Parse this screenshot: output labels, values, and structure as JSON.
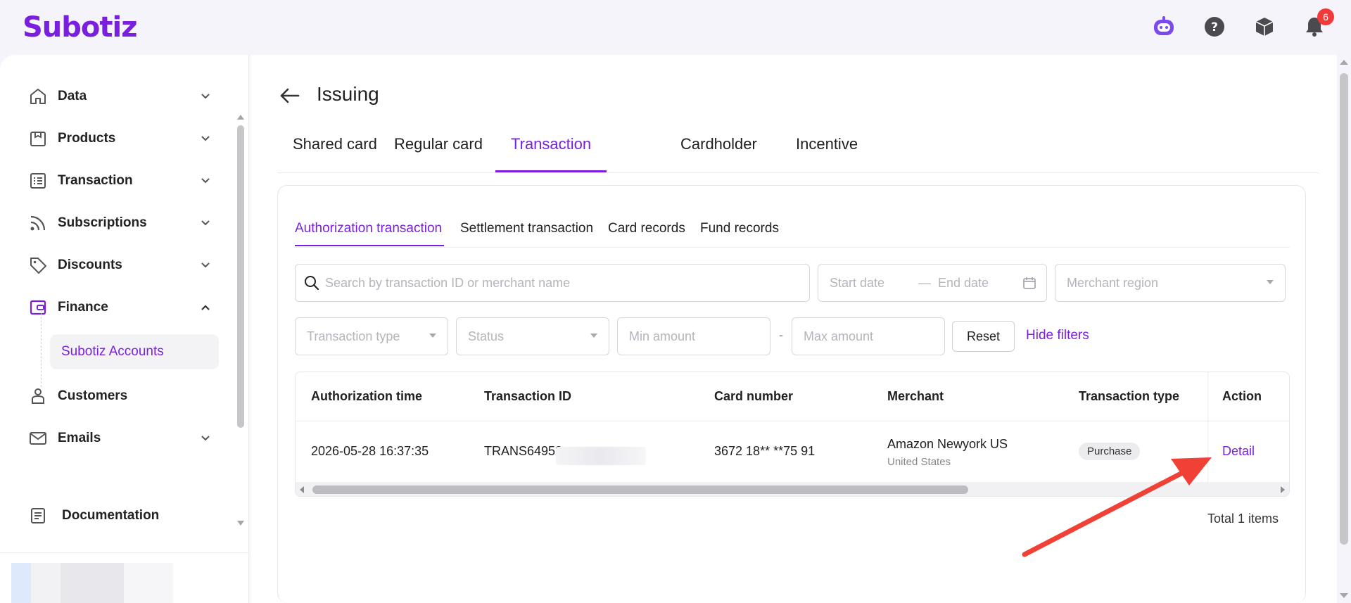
{
  "app": {
    "logo": "Subotiz",
    "notification_count": "6"
  },
  "top_icons": [
    "robot-assistant-icon",
    "help-icon",
    "package-icon",
    "bell-icon"
  ],
  "sidebar": {
    "items": [
      {
        "label": "Data",
        "icon": "home-icon",
        "expandable": true
      },
      {
        "label": "Products",
        "icon": "shop-icon",
        "expandable": true
      },
      {
        "label": "Transaction",
        "icon": "list-icon",
        "expandable": true
      },
      {
        "label": "Subscriptions",
        "icon": "rss-icon",
        "expandable": true
      },
      {
        "label": "Discounts",
        "icon": "tag-icon",
        "expandable": true
      },
      {
        "label": "Finance",
        "icon": "wallet-icon",
        "expandable": true,
        "expanded": true
      },
      {
        "label": "Customers",
        "icon": "user-icon",
        "expandable": false
      },
      {
        "label": "Emails",
        "icon": "mail-icon",
        "expandable": true
      },
      {
        "label": "Documentation",
        "icon": "document-icon",
        "expandable": false
      }
    ],
    "finance_sub": "Subotiz Accounts"
  },
  "page": {
    "title": "Issuing",
    "tabs": [
      "Shared card",
      "Regular card",
      "Transaction",
      "Cardholder",
      "Incentive"
    ],
    "active_tab": "Transaction"
  },
  "subtabs": [
    "Authorization transaction",
    "Settlement transaction",
    "Card records",
    "Fund records"
  ],
  "filters": {
    "search_placeholder": "Search by transaction ID or merchant name",
    "start_date": "Start date",
    "date_sep": "—",
    "end_date": "End date",
    "merchant_region": "Merchant region",
    "transaction_type": "Transaction type",
    "status": "Status",
    "min_amount": "Min amount",
    "amount_sep": "-",
    "max_amount": "Max amount",
    "reset": "Reset",
    "hide_filters": "Hide filters"
  },
  "table": {
    "headers": [
      "Authorization time",
      "Transaction ID",
      "Card number",
      "Merchant",
      "Transaction type",
      "Action"
    ],
    "rows": [
      {
        "time": "2026-05-28 16:37:35",
        "transaction_id": "TRANS64952",
        "card_number": "3672 18** **75 91",
        "merchant": "Amazon Newyork US",
        "merchant_region": "United States",
        "type": "Purchase",
        "action": "Detail"
      }
    ]
  },
  "total": "Total 1 items",
  "colors": {
    "brand": "#7a1fe0",
    "badge": "#f23a3a",
    "annotation_arrow": "#ef4136"
  }
}
